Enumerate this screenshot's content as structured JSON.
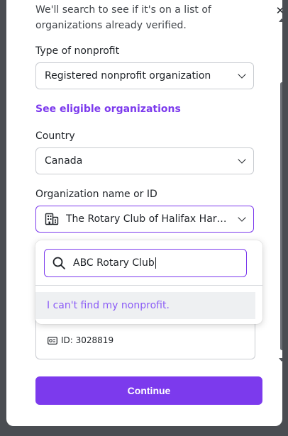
{
  "intro": {
    "line1": "We'll search to see if it's on a list of",
    "line2": "organizations already verified."
  },
  "nonprofit_type": {
    "label": "Type of nonprofit",
    "value": "Registered nonprofit organization"
  },
  "eligible_link": "See eligible organizations",
  "country": {
    "label": "Country",
    "value": "Canada"
  },
  "organization": {
    "label": "Organization name or ID",
    "value": "The Rotary Club of Halifax Harbour"
  },
  "search": {
    "value": "ABC Rotary Club"
  },
  "dropdown_option": "I can't find my nonprofit.",
  "org_id": "ID: 3028819",
  "continue_label": "Continue",
  "colors": {
    "accent": "#7c3aed",
    "option_text": "#8b5cf6"
  },
  "icons": [
    "close-icon",
    "building-icon",
    "chevron-down-icon",
    "search-icon",
    "id-card-icon"
  ]
}
